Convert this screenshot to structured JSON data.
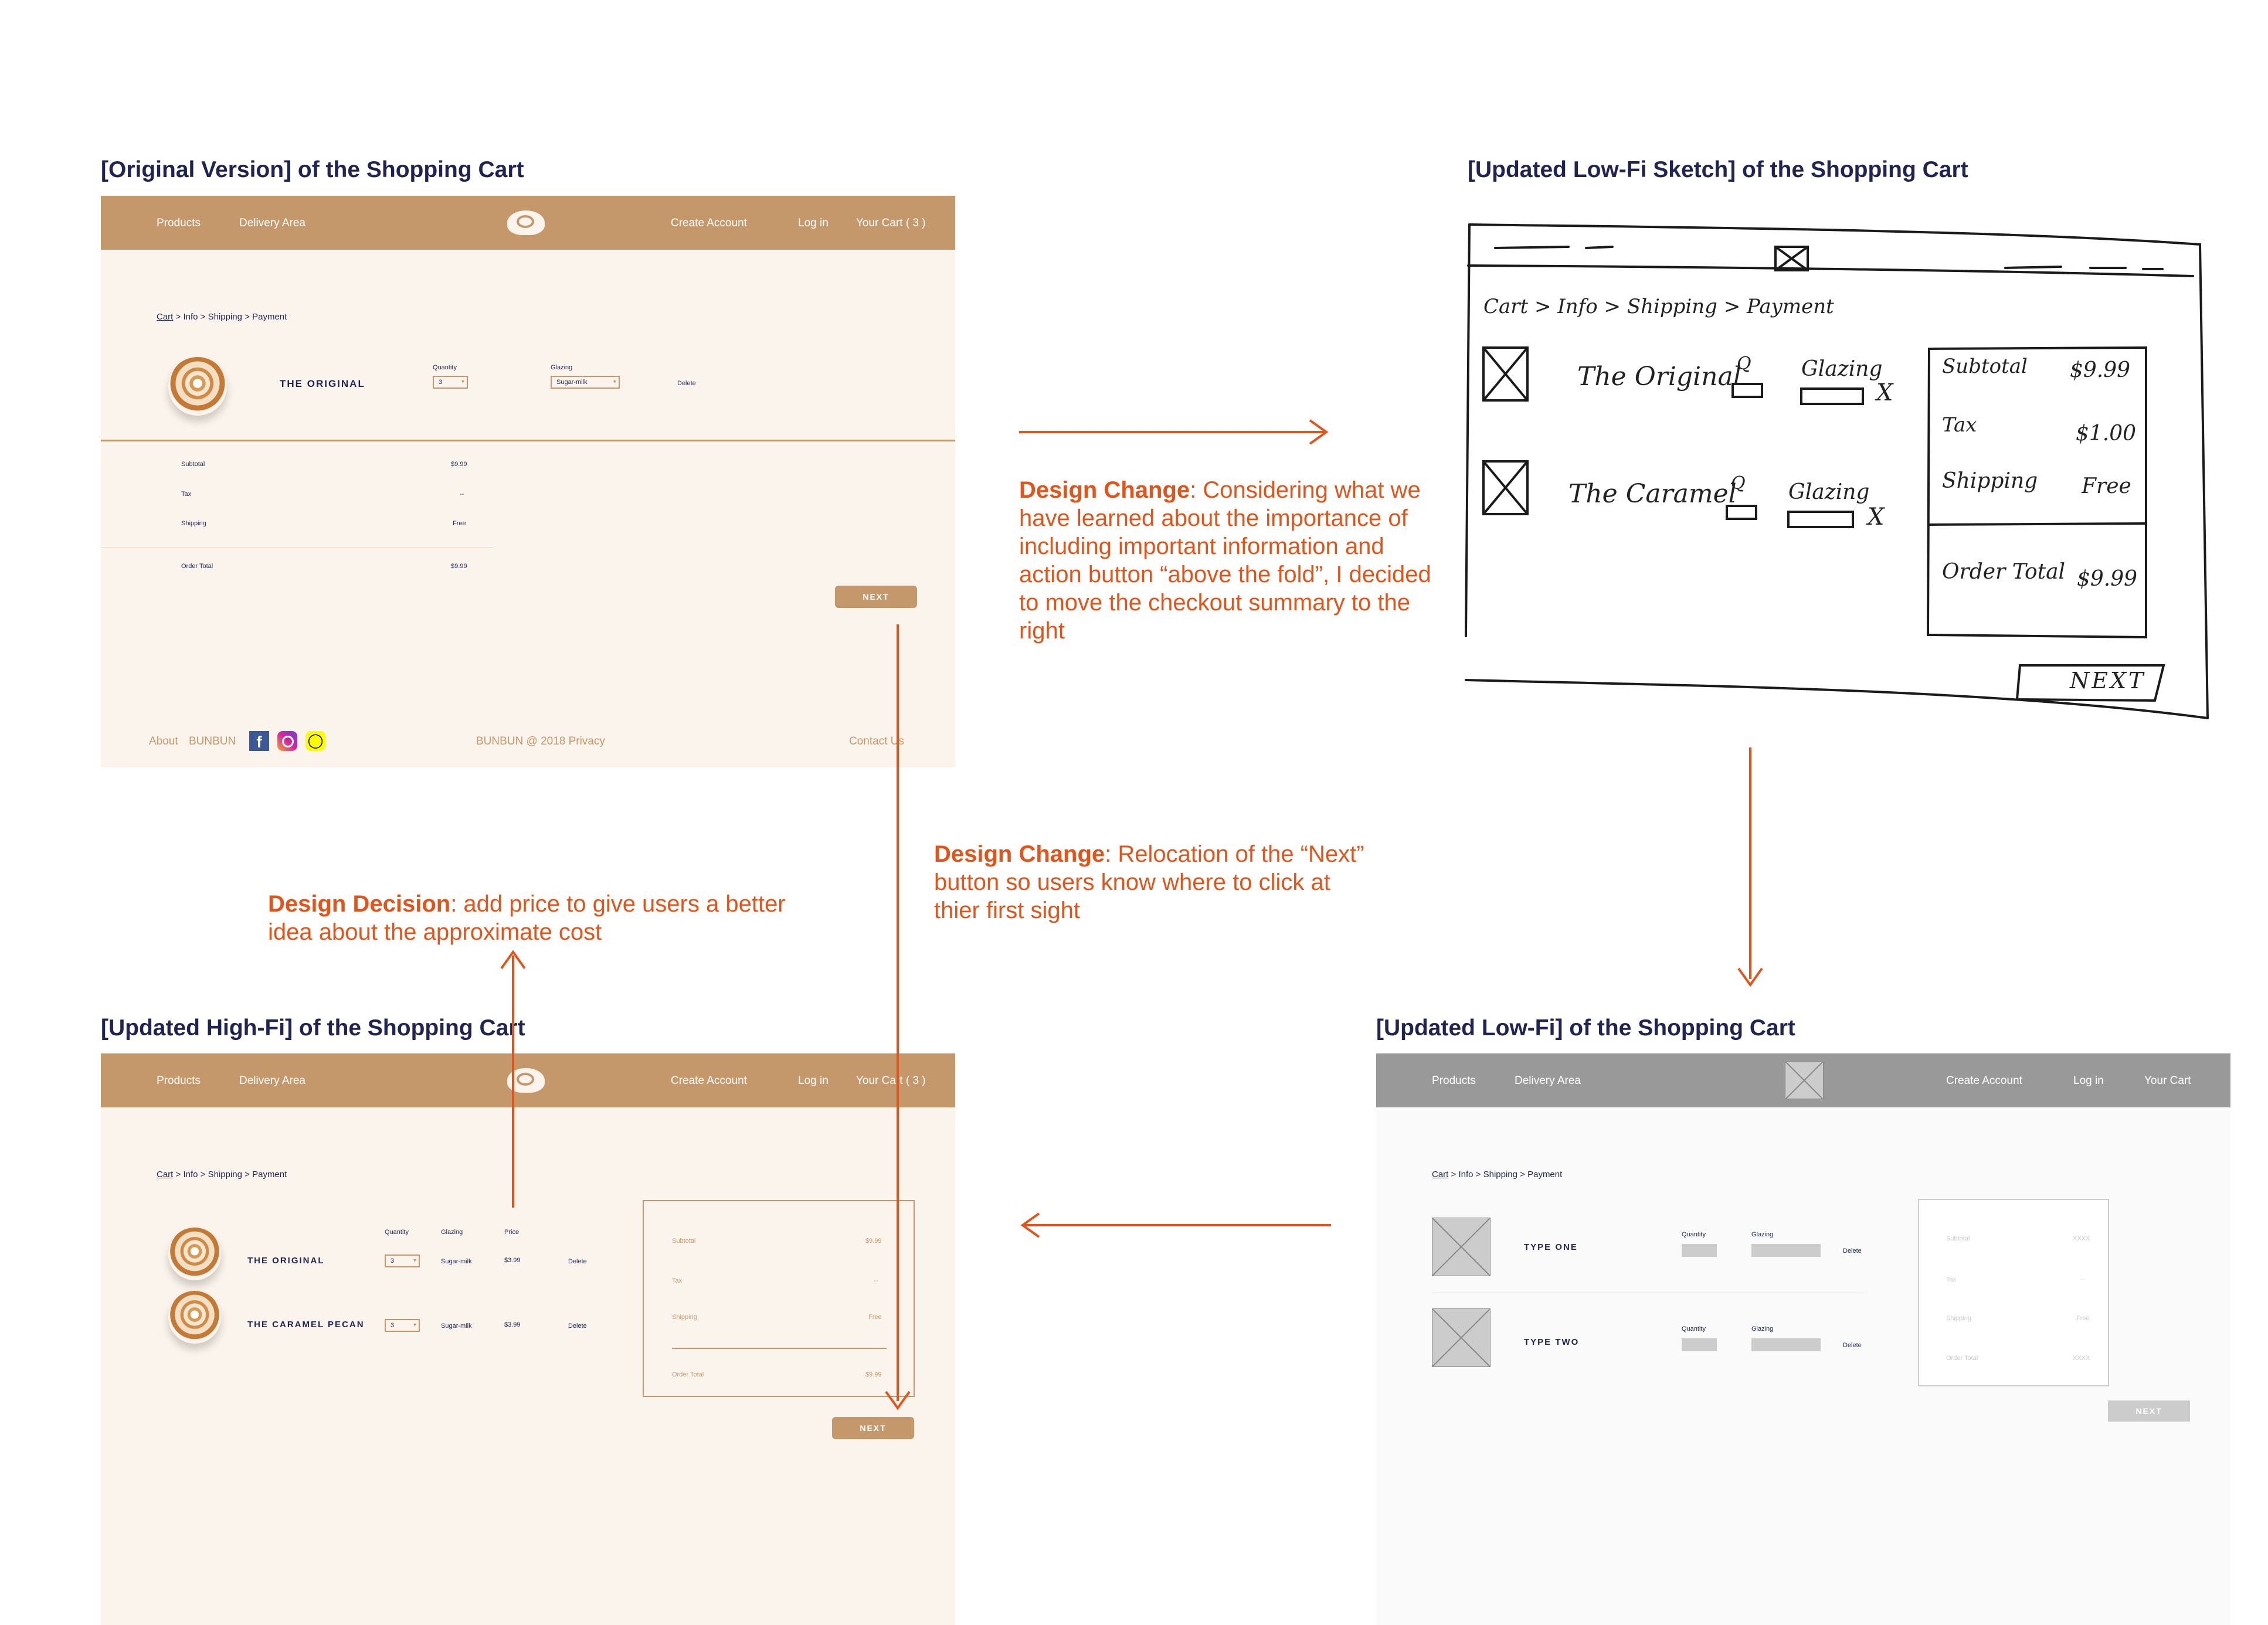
{
  "titles": {
    "original": "[Original Version] of the Shopping Cart",
    "sketch": "[Updated Low-Fi Sketch] of the Shopping Cart",
    "highfi": "[Updated High-Fi] of the Shopping Cart",
    "lowfi": "[Updated Low-Fi] of the Shopping Cart"
  },
  "notes": {
    "change1_label": "Design Change",
    "change1_text": ": Considering what we have learned about the importance of including important information and action button “above the fold”, I decided to move the checkout summary to the right",
    "change2_label": "Design Change",
    "change2_text": ": Relocation of the “Next” button so users know where to click at thier first sight",
    "decision_label": "Design Decision",
    "decision_text": ": add price to give users a better idea about the approximate cost"
  },
  "original": {
    "nav": {
      "products": "Products",
      "delivery": "Delivery Area",
      "create": "Create Account",
      "login": "Log in",
      "cart": "Your Cart ( 3 )"
    },
    "crumb": {
      "cart": "Cart",
      "sep": ">",
      "info": "Info",
      "shipping": "Shipping",
      "payment": "Payment"
    },
    "item_name": "THE ORIGINAL",
    "quantity_label": "Quantity",
    "quantity_value": "3",
    "glazing_label": "Glazing",
    "glazing_value": "Sugar-milk",
    "delete": "Delete",
    "summary": {
      "subtotal_label": "Subtotal",
      "subtotal": "$9.99",
      "tax_label": "Tax",
      "tax": "--",
      "shipping_label": "Shipping",
      "shipping": "Free",
      "total_label": "Order Total",
      "total": "$9.99"
    },
    "next": "NEXT",
    "footer": {
      "about": "About",
      "brand": "BUNBUN",
      "copyright": "BUNBUN @ 2018 Privacy",
      "contact": "Contact Us"
    }
  },
  "sketch": {
    "crumb": "Cart > Info > Shipping > Payment",
    "item1": "The Original",
    "item2": "The Caramel",
    "q": "Q",
    "glazing": "Glazing",
    "x": "X",
    "subtotal_label": "Subtotal",
    "subtotal": "$9.99",
    "tax_label": "Tax",
    "tax": "$1.00",
    "shipping_label": "Shipping",
    "shipping": "Free",
    "total_label": "Order Total",
    "total": "$9.99",
    "next": "NEXT"
  },
  "highfi": {
    "nav": {
      "products": "Products",
      "delivery": "Delivery Area",
      "create": "Create Account",
      "login": "Log in",
      "cart": "Your Cart ( 3 )"
    },
    "crumb": {
      "cart": "Cart",
      "sep": ">",
      "info": "Info",
      "shipping": "Shipping",
      "payment": "Payment"
    },
    "headers": {
      "quantity": "Quantity",
      "glazing": "Glazing",
      "price": "Price"
    },
    "items": [
      {
        "name": "THE ORIGINAL",
        "qty": "3",
        "glazing": "Sugar-milk",
        "price": "$3.99",
        "delete": "Delete"
      },
      {
        "name": "THE CARAMEL PECAN",
        "qty": "3",
        "glazing": "Sugar-milk",
        "price": "$3.99",
        "delete": "Delete"
      }
    ],
    "summary": {
      "subtotal_label": "Subtotal",
      "subtotal": "$9.99",
      "tax_label": "Tax",
      "tax": "--",
      "shipping_label": "Shipping",
      "shipping": "Free",
      "total_label": "Order Total",
      "total": "$9.99"
    },
    "next": "NEXT"
  },
  "lowfi": {
    "nav": {
      "products": "Products",
      "delivery": "Delivery Area",
      "create": "Create Account",
      "login": "Log in",
      "cart": "Your Cart"
    },
    "crumb": {
      "cart": "Cart",
      "sep": ">",
      "info": "Info",
      "shipping": "Shipping",
      "payment": "Payment"
    },
    "items": [
      {
        "name": "TYPE ONE",
        "quantity": "Quantity",
        "glazing": "Glazing",
        "delete": "Delete"
      },
      {
        "name": "TYPE TWO",
        "quantity": "Quantity",
        "glazing": "Glazing",
        "delete": "Delete"
      }
    ],
    "summary": {
      "subtotal_label": "Subtotal",
      "subtotal": "XXXX",
      "tax_label": "Tax",
      "tax": "--",
      "shipping_label": "Shipping",
      "shipping": "Free",
      "total_label": "Order Total",
      "total": "XXXX"
    },
    "next": "NEXT"
  },
  "colors": {
    "accent": "#e2541a",
    "brand": "#c4986b",
    "cream": "#fbf4ec",
    "title": "#1f2452",
    "grey_nav": "#999999"
  }
}
